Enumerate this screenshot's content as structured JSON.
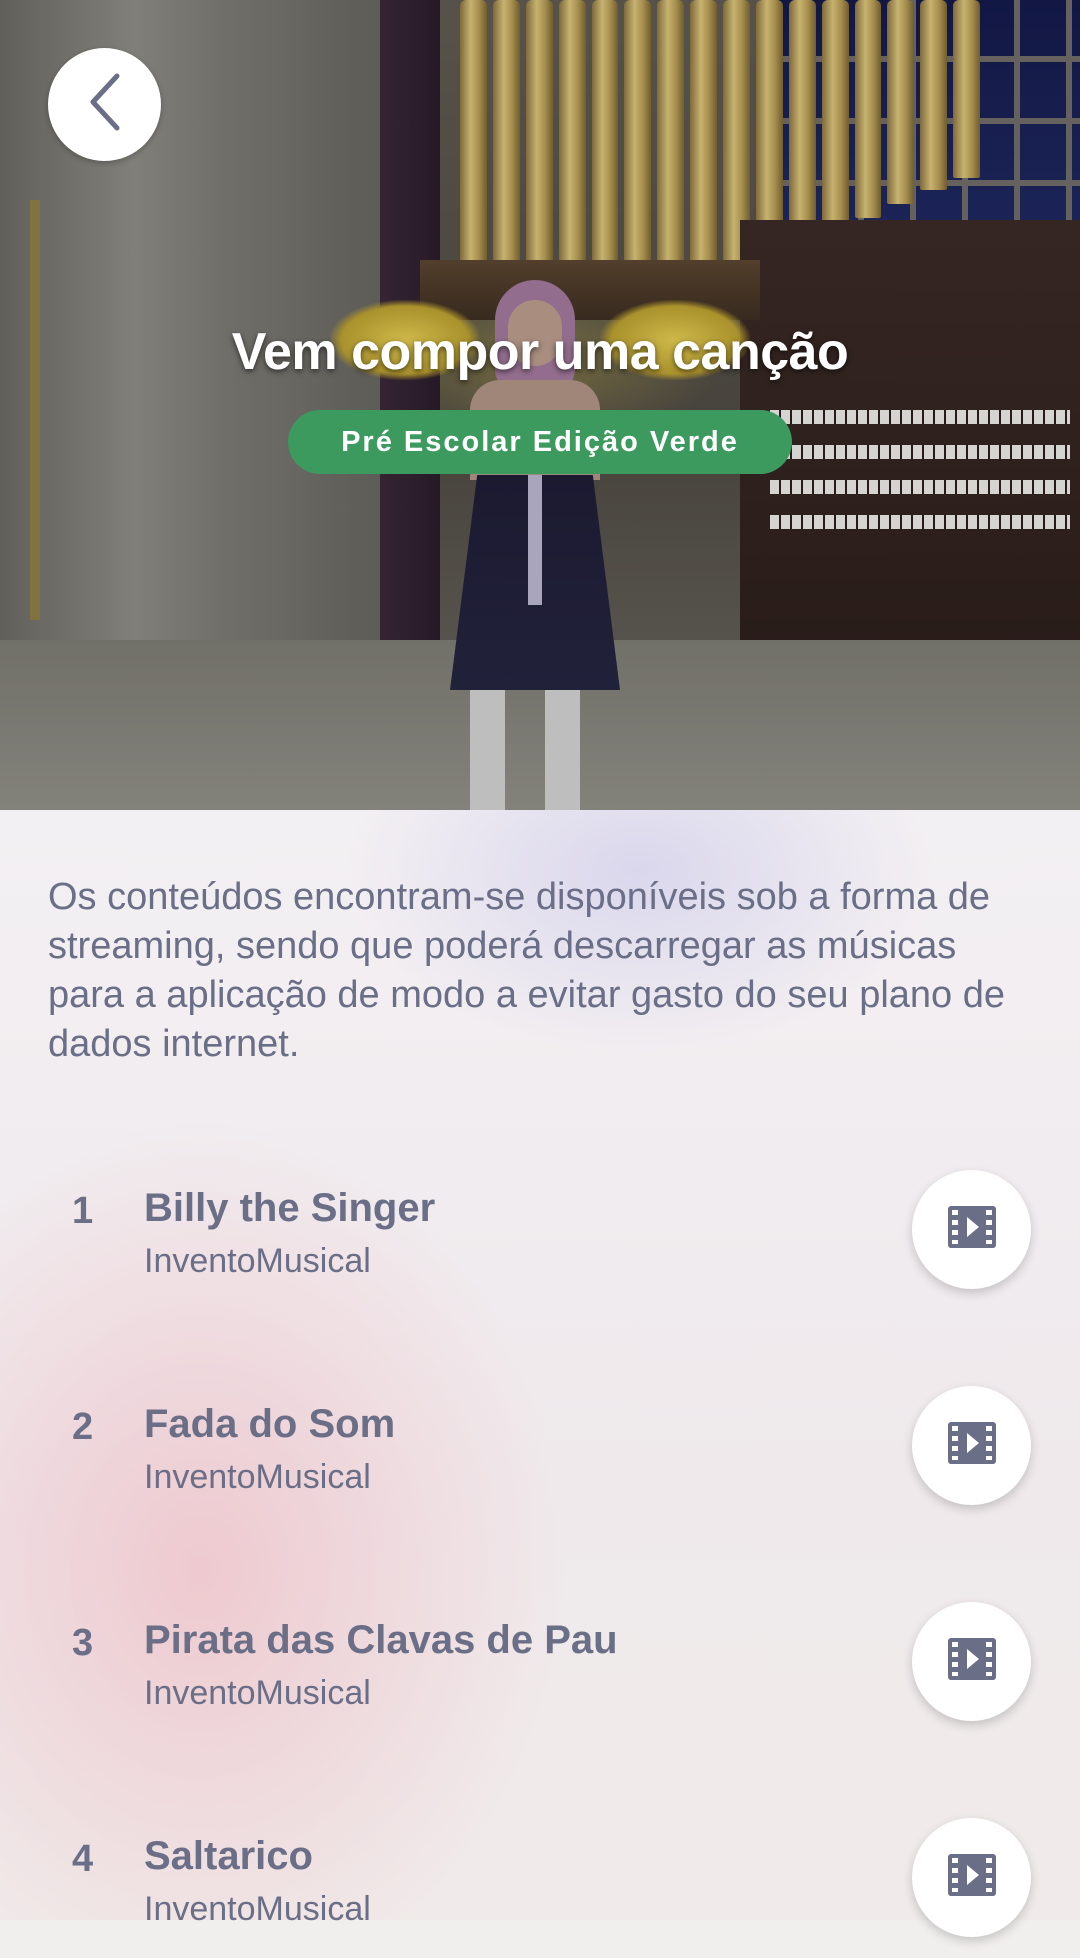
{
  "header": {
    "title": "Vem compor uma canção",
    "badge": "Pré Escolar Edição Verde",
    "back_icon": "chevron-left-icon"
  },
  "description": "Os conteúdos encontram-se disponíveis sob a forma de streaming, sendo que poderá descarregar as músicas para a aplicação de modo a evitar gasto do seu plano de dados internet.",
  "tracks": [
    {
      "number": "1",
      "title": "Billy the Singer",
      "artist": "InventoMusical",
      "icon": "film-play-icon"
    },
    {
      "number": "2",
      "title": "Fada do Som",
      "artist": "InventoMusical",
      "icon": "film-play-icon"
    },
    {
      "number": "3",
      "title": "Pirata das Clavas de Pau",
      "artist": "InventoMusical",
      "icon": "film-play-icon"
    },
    {
      "number": "4",
      "title": "Saltarico",
      "artist": "InventoMusical",
      "icon": "film-play-icon"
    }
  ],
  "colors": {
    "text": "#6a6e86",
    "badge": "#3d9a5e",
    "button_bg": "#ffffff"
  }
}
